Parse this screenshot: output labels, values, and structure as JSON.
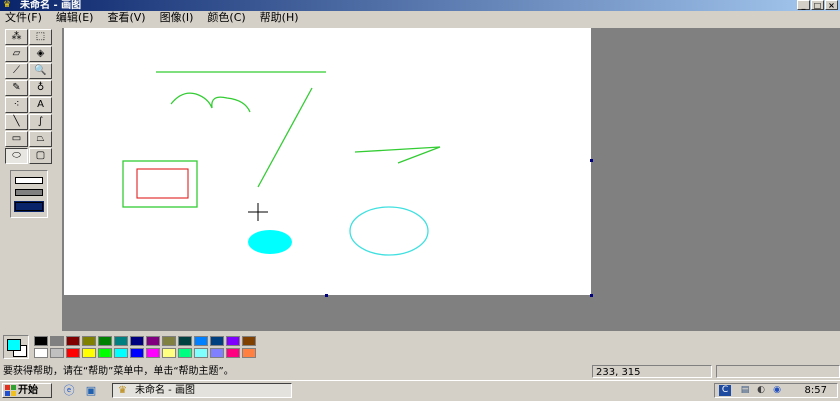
{
  "window": {
    "title": "未命名 - 画图",
    "icon": "paint-icon",
    "buttons": {
      "minimize": "_",
      "maximize": "□",
      "close": "×"
    }
  },
  "menu": [
    {
      "name": "file",
      "label": "文件(F)"
    },
    {
      "name": "edit",
      "label": "编辑(E)"
    },
    {
      "name": "view",
      "label": "查看(V)"
    },
    {
      "name": "image",
      "label": "图像(I)"
    },
    {
      "name": "colors",
      "label": "颜色(C)"
    },
    {
      "name": "help",
      "label": "帮助(H)"
    }
  ],
  "tools": [
    {
      "name": "free-select",
      "icon": "free-select-icon",
      "glyph": "⁂"
    },
    {
      "name": "select",
      "icon": "rect-select-icon",
      "glyph": "⬚"
    },
    {
      "name": "eraser",
      "icon": "eraser-icon",
      "glyph": "▱"
    },
    {
      "name": "fill",
      "icon": "fill-bucket-icon",
      "glyph": "◈"
    },
    {
      "name": "pick-color",
      "icon": "eyedropper-icon",
      "glyph": "⟋"
    },
    {
      "name": "magnifier",
      "icon": "magnifier-icon",
      "glyph": "🔍"
    },
    {
      "name": "pencil",
      "icon": "pencil-icon",
      "glyph": "✎"
    },
    {
      "name": "brush",
      "icon": "brush-icon",
      "glyph": "♁"
    },
    {
      "name": "airbrush",
      "icon": "airbrush-icon",
      "glyph": "⁖"
    },
    {
      "name": "text",
      "icon": "text-icon",
      "glyph": "A"
    },
    {
      "name": "line",
      "icon": "line-icon",
      "glyph": "╲"
    },
    {
      "name": "curve",
      "icon": "curve-icon",
      "glyph": "∫"
    },
    {
      "name": "rectangle",
      "icon": "rectangle-icon",
      "glyph": "▭"
    },
    {
      "name": "polygon",
      "icon": "polygon-icon",
      "glyph": "⏢"
    },
    {
      "name": "ellipse",
      "icon": "ellipse-icon",
      "glyph": "⬭",
      "active": true
    },
    {
      "name": "rounded-rectangle",
      "icon": "rounded-rect-icon",
      "glyph": "▢"
    }
  ],
  "colors": {
    "foreground": "#00ffff",
    "background": "#ffffff",
    "palette": [
      "#000000",
      "#808080",
      "#800000",
      "#808000",
      "#008000",
      "#008080",
      "#000080",
      "#800080",
      "#808040",
      "#004040",
      "#0080ff",
      "#004080",
      "#8000ff",
      "#804000",
      "#ffffff",
      "#c0c0c0",
      "#ff0000",
      "#ffff00",
      "#00ff00",
      "#00ffff",
      "#0000ff",
      "#ff00ff",
      "#ffff80",
      "#00ff80",
      "#80ffff",
      "#8080ff",
      "#ff0080",
      "#ff8040"
    ]
  },
  "status": {
    "help_text": "要获得帮助，请在“帮助”菜单中，单击“帮助主题”。",
    "coordinates": "233, 315"
  },
  "taskbar": {
    "start_label": "开始",
    "task_label": "未命名 - 画图",
    "clock": "8:57",
    "tray_icons": [
      "network-icon",
      "volume-icon",
      "security-icon",
      "input-method-icon"
    ]
  }
}
